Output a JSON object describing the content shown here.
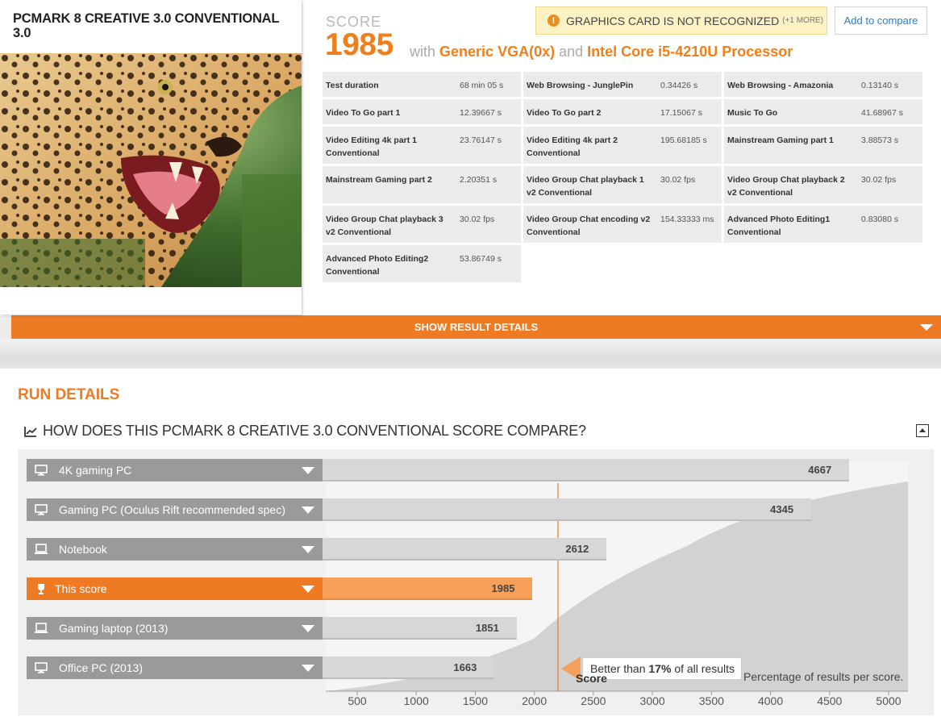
{
  "benchmark": {
    "title": "PCMARK 8 CREATIVE 3.0 CONVENTIONAL 3.0"
  },
  "score": {
    "label": "SCORE",
    "value": "1985",
    "with_text": "with",
    "gpu": "Generic VGA(0x)",
    "and_text": "and",
    "cpu": "Intel Core i5-4210U Processor"
  },
  "warning": {
    "text": "GRAPHICS CARD IS NOT RECOGNIZED",
    "more": "(+1 MORE)",
    "icon": "warning-icon"
  },
  "compare_button": "Add to compare",
  "subscores": [
    {
      "name": "Test duration",
      "value": "68 min 05 s"
    },
    {
      "name": "Web Browsing - JunglePin",
      "value": "0.34426 s"
    },
    {
      "name": "Web Browsing - Amazonia",
      "value": "0.13140 s"
    },
    {
      "name": "Video To Go part 1",
      "value": "12.39667 s"
    },
    {
      "name": "Video To Go part 2",
      "value": "17.15067 s"
    },
    {
      "name": "Music To Go",
      "value": "41.68967 s"
    },
    {
      "name": "Video Editing 4k part 1 Conventional",
      "value": "23.76147 s"
    },
    {
      "name": "Video Editing 4k part 2 Conventional",
      "value": "195.68185 s"
    },
    {
      "name": "Mainstream Gaming part 1",
      "value": "3.88573 s"
    },
    {
      "name": "Mainstream Gaming part 2",
      "value": "2.20351 s"
    },
    {
      "name": "Video Group Chat playback 1 v2 Conventional",
      "value": "30.02 fps"
    },
    {
      "name": "Video Group Chat playback 2 v2 Conventional",
      "value": "30.02 fps"
    },
    {
      "name": "Video Group Chat playback 3 v2 Conventional",
      "value": "30.02 fps"
    },
    {
      "name": "Video Group Chat encoding v2 Conventional",
      "value": "154.33333 ms"
    },
    {
      "name": "Advanced Photo Editing1 Conventional",
      "value": "0.83080 s"
    },
    {
      "name": "Advanced Photo Editing2 Conventional",
      "value": "53.86749 s"
    }
  ],
  "show_details": "SHOW RESULT DETAILS",
  "run_details": {
    "title": "RUN DETAILS",
    "compare_title": "HOW DOES THIS PCMARK 8 CREATIVE 3.0 CONVENTIONAL SCORE COMPARE?",
    "callout": {
      "prefix": "Better than",
      "percent": "17%",
      "suffix": "of all results"
    },
    "axis_title": "Score",
    "distribution_label": "Percentage of results per score."
  },
  "chart_data": {
    "type": "bar",
    "orientation": "horizontal",
    "categories": [
      "4K gaming PC",
      "Gaming PC (Oculus Rift recommended spec)",
      "Notebook",
      "This score",
      "Gaming laptop (2013)",
      "Office PC (2013)"
    ],
    "values": [
      4667,
      4345,
      2612,
      1985,
      1851,
      1663
    ],
    "highlight": "This score",
    "x_ticks": [
      500,
      1000,
      1500,
      2000,
      2500,
      3000,
      3500,
      4000,
      4500,
      5000
    ],
    "xlabel": "Score",
    "better_than_percent": 17,
    "colors": {
      "bar": "#d7d7d7",
      "highlight": "#f6a05c",
      "accent": "#ee7a24",
      "label_bg": "#9a9a9a"
    }
  }
}
